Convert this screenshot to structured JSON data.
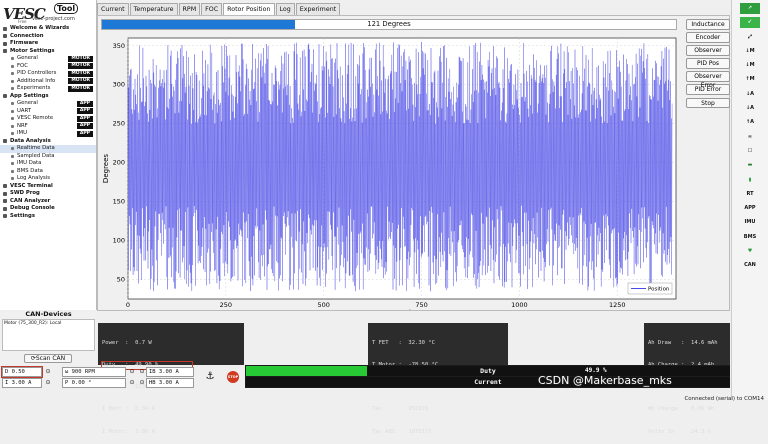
{
  "logo": {
    "mark": "VESC",
    "tool": "Tool",
    "url": "vesc-project.com",
    "free": "Free"
  },
  "sidebar": [
    {
      "label": "Welcome & Wizards",
      "type": "h"
    },
    {
      "label": "Connection",
      "type": "h"
    },
    {
      "label": "Firmware",
      "type": "h"
    },
    {
      "label": "Motor Settings",
      "type": "h"
    },
    {
      "label": "General",
      "type": "s",
      "badge": "MOTOR"
    },
    {
      "label": "FOC",
      "type": "s",
      "badge": "MOTOR"
    },
    {
      "label": "PID Controllers",
      "type": "s",
      "badge": "MOTOR"
    },
    {
      "label": "Additional Info",
      "type": "s",
      "badge": "MOTOR"
    },
    {
      "label": "Experiments",
      "type": "s",
      "badge": "MOTOR"
    },
    {
      "label": "App Settings",
      "type": "h"
    },
    {
      "label": "General",
      "type": "s",
      "badge": "APP"
    },
    {
      "label": "UART",
      "type": "s",
      "badge": "APP"
    },
    {
      "label": "VESC Remote",
      "type": "s",
      "badge": "APP"
    },
    {
      "label": "NRF",
      "type": "s",
      "badge": "APP"
    },
    {
      "label": "IMU",
      "type": "s",
      "badge": "APP"
    },
    {
      "label": "Data Analysis",
      "type": "h"
    },
    {
      "label": "Realtime Data",
      "type": "s",
      "selected": true
    },
    {
      "label": "Sampled Data",
      "type": "s"
    },
    {
      "label": "IMU Data",
      "type": "s"
    },
    {
      "label": "BMS Data",
      "type": "s"
    },
    {
      "label": "Log Analysis",
      "type": "s"
    },
    {
      "label": "VESC Terminal",
      "type": "h"
    },
    {
      "label": "SWD Prog",
      "type": "h"
    },
    {
      "label": "CAN Analyzer",
      "type": "h"
    },
    {
      "label": "Debug Console",
      "type": "h"
    },
    {
      "label": "Settings",
      "type": "h"
    }
  ],
  "tabs": [
    "Current",
    "Temperature",
    "RPM",
    "FOC",
    "Rotor Position",
    "Log",
    "Experiment"
  ],
  "active_tab": "Rotor Position",
  "progress": {
    "label": "121 Degrees",
    "fraction": 0.336
  },
  "side_buttons": [
    "Inductance",
    "Encoder",
    "Observer",
    "PID Pos",
    "Observer Error",
    "PID Error",
    "Stop"
  ],
  "chart_data": {
    "type": "line",
    "xlabel": "Sample",
    "ylabel": "Degrees",
    "xlim": [
      0,
      1400
    ],
    "ylim": [
      25,
      360
    ],
    "xticks": [
      0,
      250,
      500,
      750,
      1000,
      1250
    ],
    "yticks": [
      50,
      100,
      150,
      200,
      250,
      300,
      350
    ],
    "legend": "bottom-right",
    "grid": true,
    "series": [
      {
        "name": "Position",
        "color": "#4a4ae6",
        "pattern": "sawtooth 0–360° per revolution, ~2 samples per cycle",
        "period_samples": 2
      }
    ]
  },
  "can_devices": {
    "title": "CAN-Devices",
    "items": [
      "Motor (75_300_R2): Local"
    ],
    "scan": "Scan CAN"
  },
  "stats1": [
    "Power  :  0.7 W",
    "Duty   :  49.90 %",
    "ERPM   :  52362.0",
    "I Batt :  0.34 A",
    "I Motor:  1.06 A"
  ],
  "stats2": [
    "T FET   :  32.30 °C",
    "T Motor :  -78.50 °C",
    "Fault   :  NONE",
    "Tac     :  952378",
    "Tac ABS :  1075172"
  ],
  "stats3": [
    "Ah Draw   :  14.6 mAh",
    "Ah Charge :  2.4 mAh",
    "Wh Draw   :  0.36 Wh",
    "Wh Charge :  0.06 Wh",
    "Volts In  :  24.3 V"
  ],
  "controls": {
    "duty": "D 0.50",
    "rpm": "ω 900 RPM",
    "current": "I 3.00 A",
    "pos": "P 0.00 °",
    "ib": "IB 3.00 A",
    "hb": "HB 3.00 A"
  },
  "bars": {
    "duty_label": "Duty",
    "duty_value": "49.9 %",
    "duty_fraction": 0.499,
    "current_label": "Current"
  },
  "watermark": "CSDN @Makerbase_mks",
  "status": "Connected (serial) to COM14"
}
